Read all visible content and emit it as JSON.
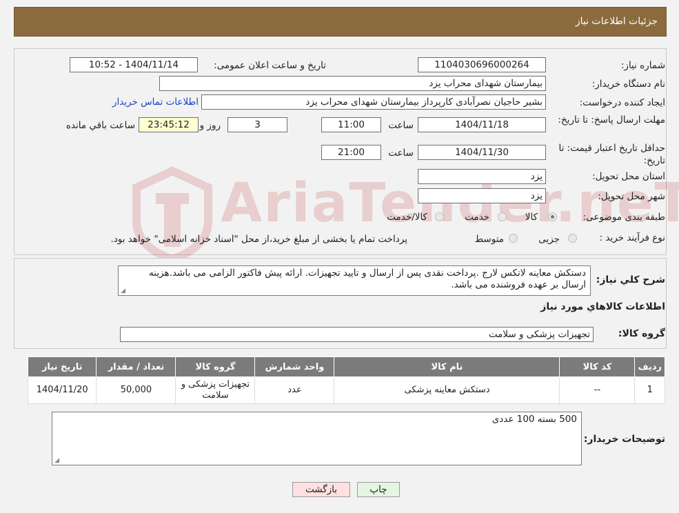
{
  "header": {
    "title": "جزئیات اطلاعات نیاز"
  },
  "fields": {
    "need_number_label": "شماره نیاز:",
    "need_number": "1104030696000264",
    "announce_label": "تاریخ و ساعت اعلان عمومی:",
    "announce_value": "1404/11/14 - 10:52",
    "buyer_label": "نام دستگاه خریدار:",
    "buyer_value": "بیمارستان شهدای محراب یزد",
    "creator_label": "ایجاد کننده درخواست:",
    "creator_value": "بشیر حاجیان نصرآبادی کارپرداز بیمارستان شهدای محراب یزد",
    "contact_link": "اطلاعات تماس خریدار",
    "deadline_label": "مهلت ارسال پاسخ: تا تاریخ:",
    "deadline_date": "1404/11/18",
    "time_label": "ساعت",
    "deadline_time": "11:00",
    "days_value": "3",
    "days_label": "روز و",
    "remaining_value": "23:45:12",
    "remaining_label": "ساعت باقي مانده",
    "validity_label": "حداقل تاریخ اعتبار قیمت: تا تاریخ:",
    "validity_date": "1404/11/30",
    "validity_time": "21:00",
    "province_label": "استان محل تحویل:",
    "province_value": "یزد",
    "city_label": "شهر محل تحویل:",
    "city_value": "یزد",
    "category_label": "طبقه بندی موضوعی:",
    "category_options": [
      "کالا",
      "خدمت",
      "کالا/خدمت"
    ],
    "category_selected": "کالا",
    "process_label": "نوع فرآیند خرید :",
    "process_options": [
      "جزیی",
      "متوسط"
    ],
    "process_note": "پرداخت تمام یا بخشی از مبلغ خرید،از محل \"اسناد خزانه اسلامی\" خواهد بود."
  },
  "description": {
    "label": "شرح کلي نياز:",
    "text": "دستکش معاینه لاتکس لارج .پرداخت نقدی  پس از ارسال و تایید تجهیزات. ارائه پیش فاکتور الزامی می باشد.هزینه ارسال بر عهده فروشنده می باشد."
  },
  "goods_section": {
    "title": "اطلاعات كالاهاي مورد نياز",
    "group_label": "گروه کالا:",
    "group_value": "تجهیزات پزشکی و سلامت"
  },
  "table": {
    "headers": [
      "رديف",
      "کد کالا",
      "نام کالا",
      "واحد شمارش",
      "گروه کالا",
      "تعداد / مقدار",
      "تاریخ نیاز"
    ],
    "rows": [
      [
        "1",
        "--",
        "دستکش معاینه پزشکی",
        "عدد",
        "تجهیزات پزشکی و سلامت",
        "50,000",
        "1404/11/20"
      ]
    ]
  },
  "buyer_notes": {
    "label": "توضیحات خریدار:",
    "text": "500 بسته 100 عددی"
  },
  "buttons": {
    "print": "چاپ",
    "back": "بازگشت"
  },
  "watermark": {
    "text": "AriaTender.neT"
  },
  "colors": {
    "header": "#8b6b3d",
    "table_header": "#7b7b7b",
    "link": "#1a44c8",
    "back_button": "#ffe0e0",
    "print_button": "#e4f5e1"
  }
}
